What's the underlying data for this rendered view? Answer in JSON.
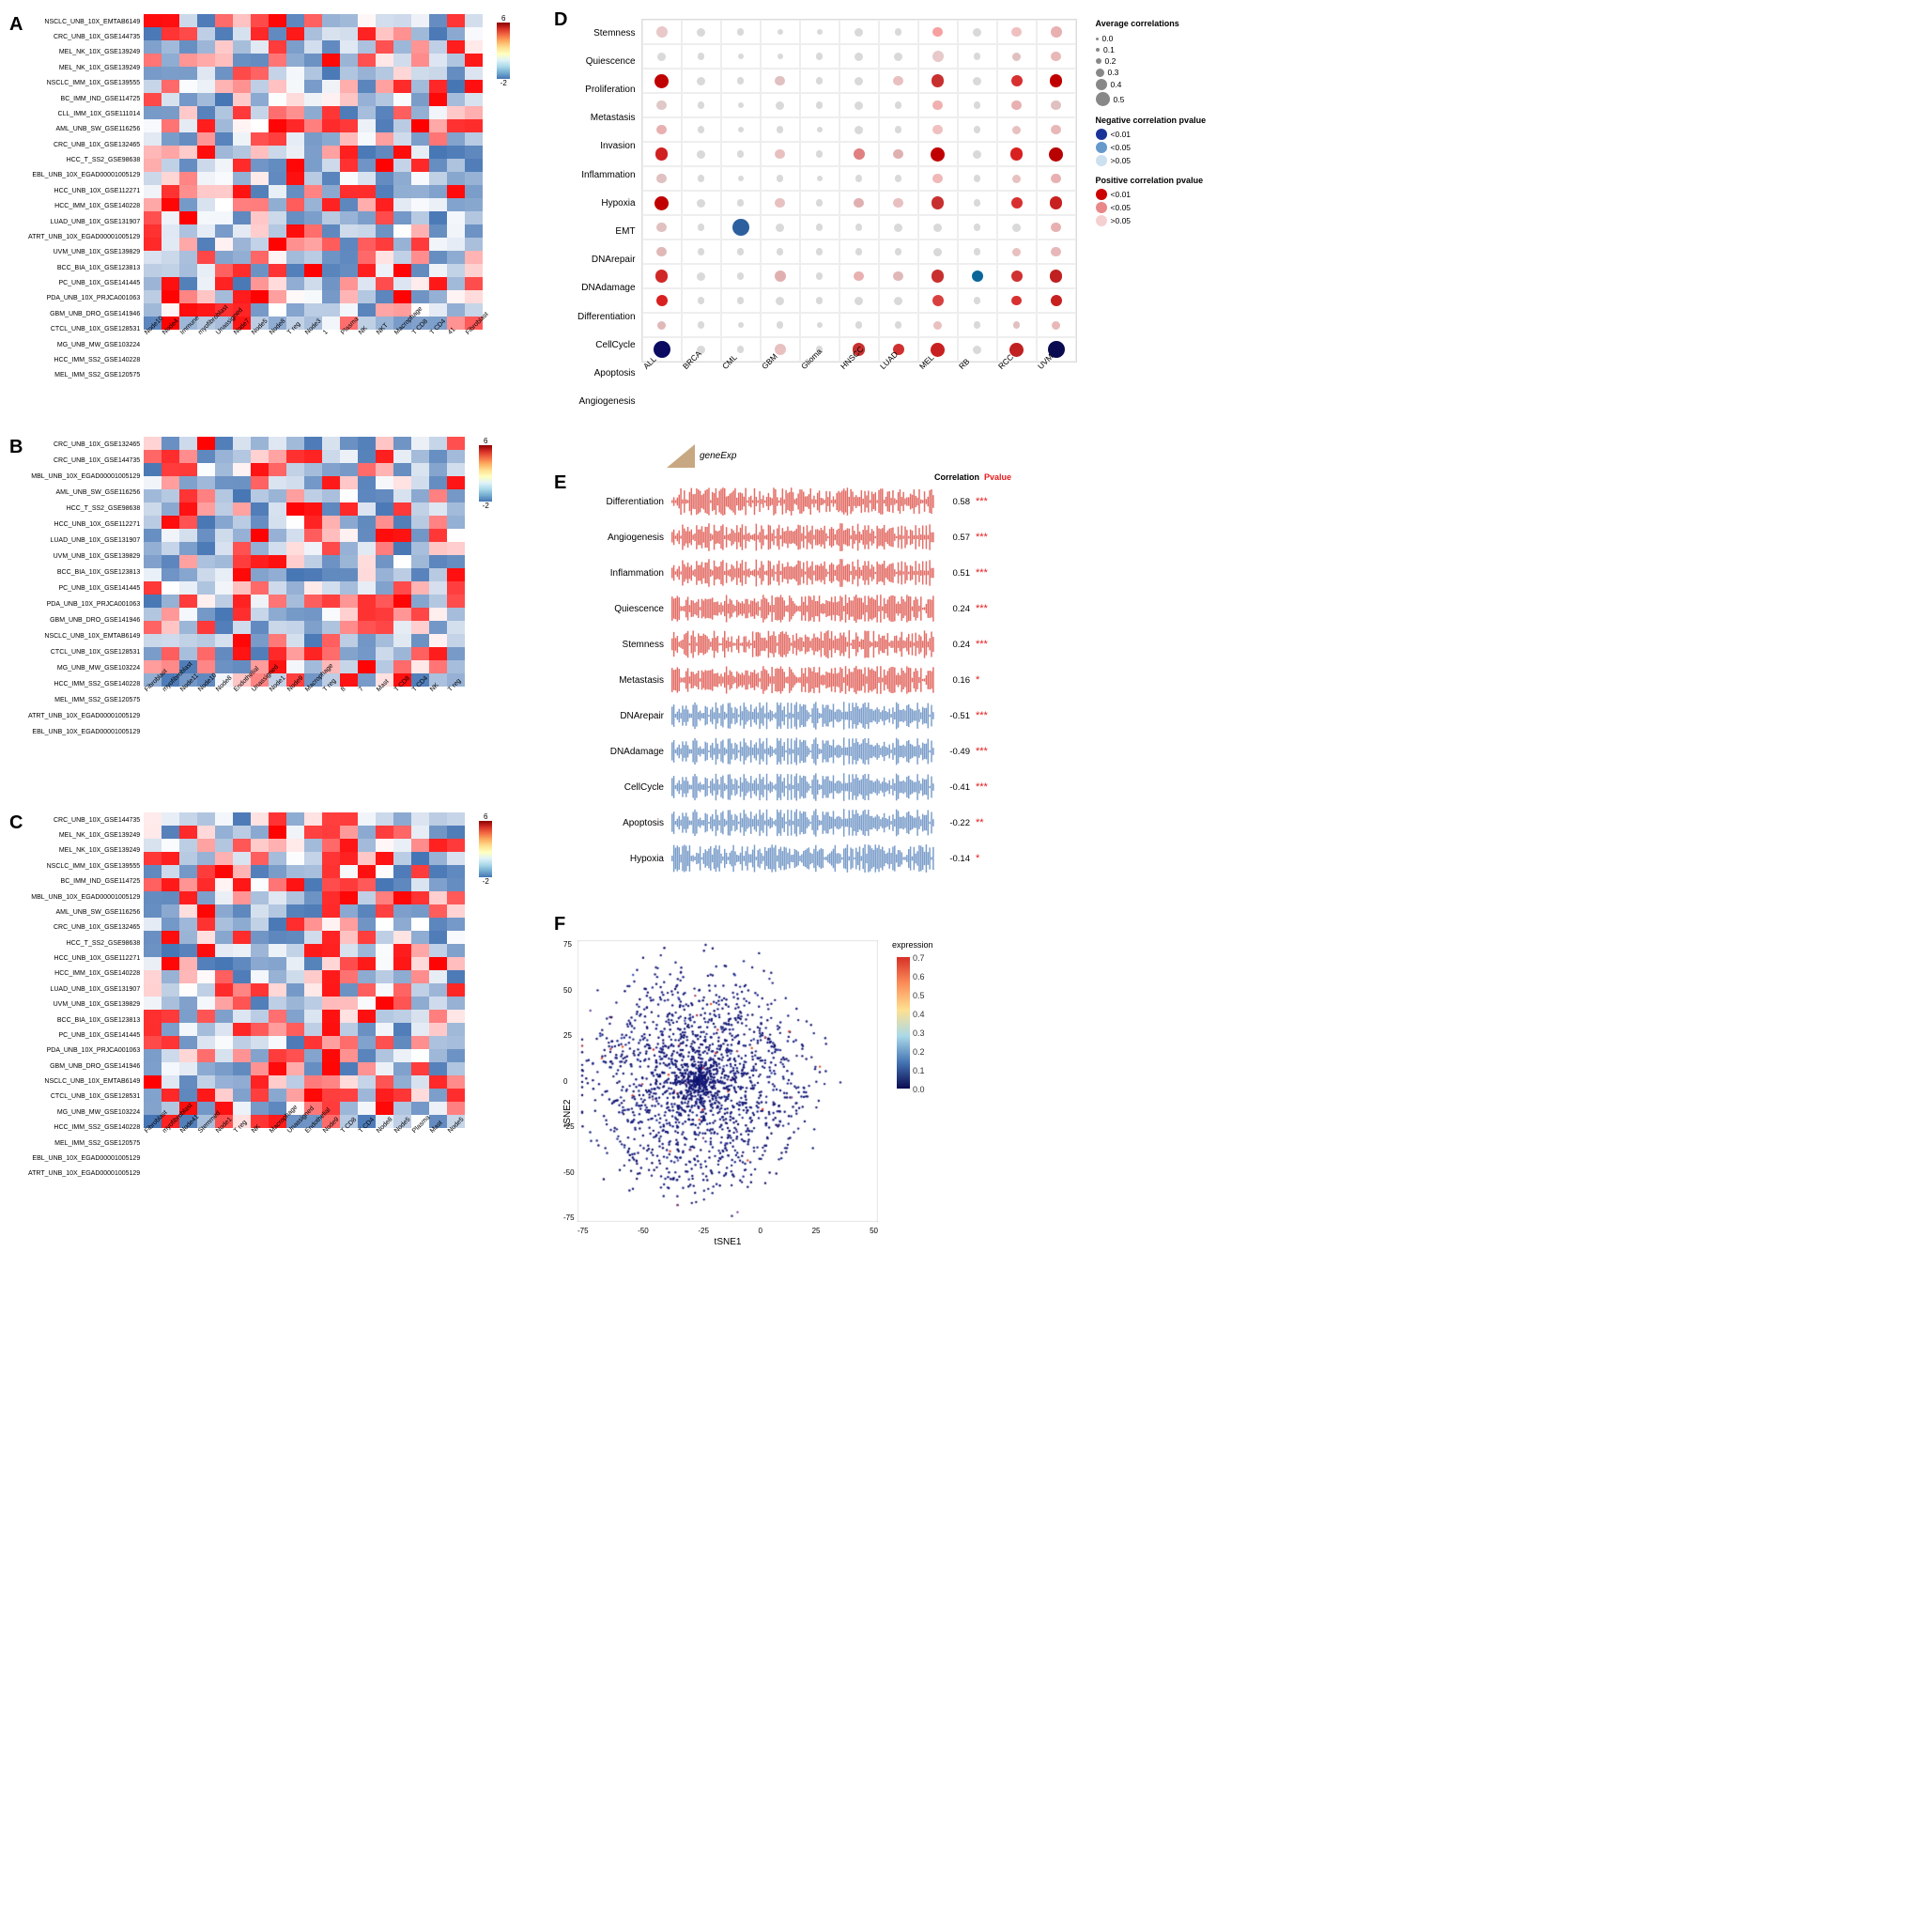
{
  "labels": {
    "sectionA": "A",
    "sectionB": "B",
    "sectionC": "C",
    "sectionD": "D",
    "sectionE": "E",
    "sectionF": "F"
  },
  "heatmapA": {
    "yLabels": [
      "NSCLC_UNB_10X_EMTAB6149",
      "CRC_UNB_10X_GSE144735",
      "MEL_NK_10X_GSE139249",
      "MEL_NK_10X_GSE139249",
      "NSCLC_IMM_10X_GSE139555",
      "BC_IMM_IND_GSE114725",
      "CLL_IMM_10X_GSE111014",
      "AML_UNB_SW_GSE116256",
      "CRC_UNB_10X_GSE132465",
      "HCC_T_SS2_GSE98638",
      "EBL_UNB_10X_EGAD00001005129",
      "HCC_UNB_10X_GSE112271",
      "HCC_IMM_10X_GSE140228",
      "LUAD_UNB_10X_GSE131907",
      "ATRT_UNB_10X_EGAD00001005129",
      "UVM_UNB_10X_GSE139829",
      "BCC_BIA_10X_GSE123813",
      "PC_UNB_10X_GSE141445",
      "PDA_UNB_10X_PRJCA001063",
      "GBM_UNB_DRO_GSE141946",
      "CTCL_UNB_10X_GSE128531",
      "MG_UNB_MW_GSE103224",
      "HCC_IMM_SS2_GSE140228",
      "MEL_IMM_SS2_GSE120575"
    ],
    "xLabels": [
      "Node10",
      "Node4",
      "Immune",
      "myofibroblast",
      "Unassigned",
      "Node7",
      "Node5",
      "Node8",
      "T reg",
      "Node3",
      "1",
      "Plasma",
      "NK",
      "NKT",
      "Macrophage",
      "T CD8",
      "T CD4",
      "41",
      "Fibroblast"
    ],
    "colorbarMax": "6",
    "colorbarMin": "-2"
  },
  "heatmapB": {
    "yLabels": [
      "CRC_UNB_10X_GSE132465",
      "CRC_UNB_10X_GSE144735",
      "MBL_UNB_10X_EGAD00001005129",
      "AML_UNB_SW_GSE116256",
      "HCC_T_SS2_GSE98638",
      "HCC_UNB_10X_GSE112271",
      "LUAD_UNB_10X_GSE131907",
      "UVM_UNB_10X_GSE139829",
      "BCC_BIA_10X_GSE123813",
      "PC_UNB_10X_GSE141445",
      "PDA_UNB_10X_PRJCA001063",
      "GBM_UNB_DRO_GSE141946",
      "NSCLC_UNB_10X_EMTAB6149",
      "CTCL_UNB_10X_GSE128531",
      "MG_UNB_MW_GSE103224",
      "HCC_IMM_SS2_GSE140228",
      "MEL_IMM_SS2_GSE120575",
      "ATRT_UNB_10X_EGAD00001005129",
      "EBL_UNB_10X_EGAD00001005129"
    ],
    "xLabels": [
      "Fibroblast",
      "myofibroblast",
      "Node11",
      "Node10",
      "Node8",
      "Endothelial",
      "Unassigned",
      "Node1",
      "Node9",
      "Macrophage",
      "T reg",
      "8",
      "7",
      "Mast",
      "T CD8",
      "T CD4",
      "NK",
      "T reg"
    ],
    "colorbarMax": "6",
    "colorbarMin": "-2"
  },
  "heatmapC": {
    "yLabels": [
      "CRC_UNB_10X_GSE144735",
      "MEL_NK_10X_GSE139249",
      "MEL_NK_10X_GSE139249",
      "NSCLC_IMM_10X_GSE139555",
      "BC_IMM_IND_GSE114725",
      "MBL_UNB_10X_EGAD00001005129",
      "AML_UNB_SW_GSE116256",
      "CRC_UNB_10X_GSE132465",
      "HCC_T_SS2_GSE98638",
      "HCC_UNB_10X_GSE112271",
      "HCC_IMM_10X_GSE140228",
      "LUAD_UNB_10X_GSE131907",
      "UVM_UNB_10X_GSE139829",
      "BCC_BIA_10X_GSE123813",
      "PC_UNB_10X_GSE141445",
      "PDA_UNB_10X_PRJCA001063",
      "GBM_UNB_DRO_GSE141946",
      "NSCLC_UNB_10X_EMTAB6149",
      "CTCL_UNB_10X_GSE128531",
      "MG_UNB_MW_GSE103224",
      "HCC_IMM_SS2_GSE140228",
      "MEL_IMM_SS2_GSE120575",
      "EBL_UNB_10X_EGAD00001005129",
      "ATRT_UNB_10X_EGAD00001005129"
    ],
    "xLabels": [
      "Fibroblast",
      "myofibroblast",
      "Node41",
      "Stemmed",
      "Node1",
      "T reg",
      "NK",
      "Macrophage",
      "Unassigned",
      "Endothelial",
      "Node9",
      "T CD8",
      "T CD4",
      "Node8",
      "Node5",
      "Plasma",
      "Mast",
      "Node5"
    ],
    "colorbarMax": "6",
    "colorbarMin": "-2"
  },
  "dotPlot": {
    "title": "D",
    "yLabels": [
      "Stemness",
      "Quiescence",
      "Proliferation",
      "Metastasis",
      "Invasion",
      "Inflammation",
      "Hypoxia",
      "EMT",
      "DNArepair",
      "DNAdamage",
      "Differentiation",
      "CellCycle",
      "Apoptosis",
      "Angiogenesis"
    ],
    "xLabels": [
      "ALL",
      "BRCA",
      "CML",
      "GBM",
      "Glioma",
      "HNSCC",
      "LUAD",
      "MEL",
      "RB",
      "RCC",
      "UVM"
    ],
    "legend": {
      "avgCorrTitle": "Average correlations",
      "avgCorrItems": [
        "0.0",
        "0.1",
        "0.2",
        "0.3",
        "0.4",
        "0.5"
      ],
      "negPvalTitle": "Negative correlation pvalue",
      "negPvalItems": [
        "<0.01",
        "<0.05",
        ">0.05"
      ],
      "posPvalTitle": "Positive correlation pvalue",
      "posPvalItems": [
        "<0.01",
        "<0.05",
        ">0.05"
      ]
    }
  },
  "correlations": {
    "title": "E",
    "headerCorr": "Correlation",
    "headerPval": "Pvalue",
    "geneExpLabel": "geneExp",
    "rows": [
      {
        "label": "Differentiation",
        "value": 0.58,
        "pvalue": "***",
        "positive": true
      },
      {
        "label": "Angiogenesis",
        "value": 0.57,
        "pvalue": "***",
        "positive": true
      },
      {
        "label": "Inflammation",
        "value": 0.51,
        "pvalue": "***",
        "positive": true
      },
      {
        "label": "Quiescence",
        "value": 0.24,
        "pvalue": "***",
        "positive": true
      },
      {
        "label": "Stemness",
        "value": 0.24,
        "pvalue": "***",
        "positive": true
      },
      {
        "label": "Metastasis",
        "value": 0.16,
        "pvalue": "*",
        "positive": true
      },
      {
        "label": "DNArepair",
        "value": -0.51,
        "pvalue": "***",
        "positive": false
      },
      {
        "label": "DNAdamage",
        "value": -0.49,
        "pvalue": "***",
        "positive": false
      },
      {
        "label": "CellCycle",
        "value": -0.41,
        "pvalue": "***",
        "positive": false
      },
      {
        "label": "Apoptosis",
        "value": -0.22,
        "pvalue": "**",
        "positive": false
      },
      {
        "label": "Hypoxia",
        "value": -0.14,
        "pvalue": "*",
        "positive": false
      }
    ]
  },
  "tsne": {
    "title": "F",
    "xAxisLabel": "tSNE1",
    "yAxisLabel": "tSNE2",
    "xRange": [
      -75,
      50
    ],
    "yRange": [
      -75,
      50
    ],
    "legendMin": "0.0",
    "legendMax": "0.7",
    "legendTitle": "expression",
    "legendValues": [
      "0.7",
      "0.6",
      "0.5",
      "0.4",
      "0.3",
      "0.2",
      "0.1",
      "0.0"
    ]
  }
}
